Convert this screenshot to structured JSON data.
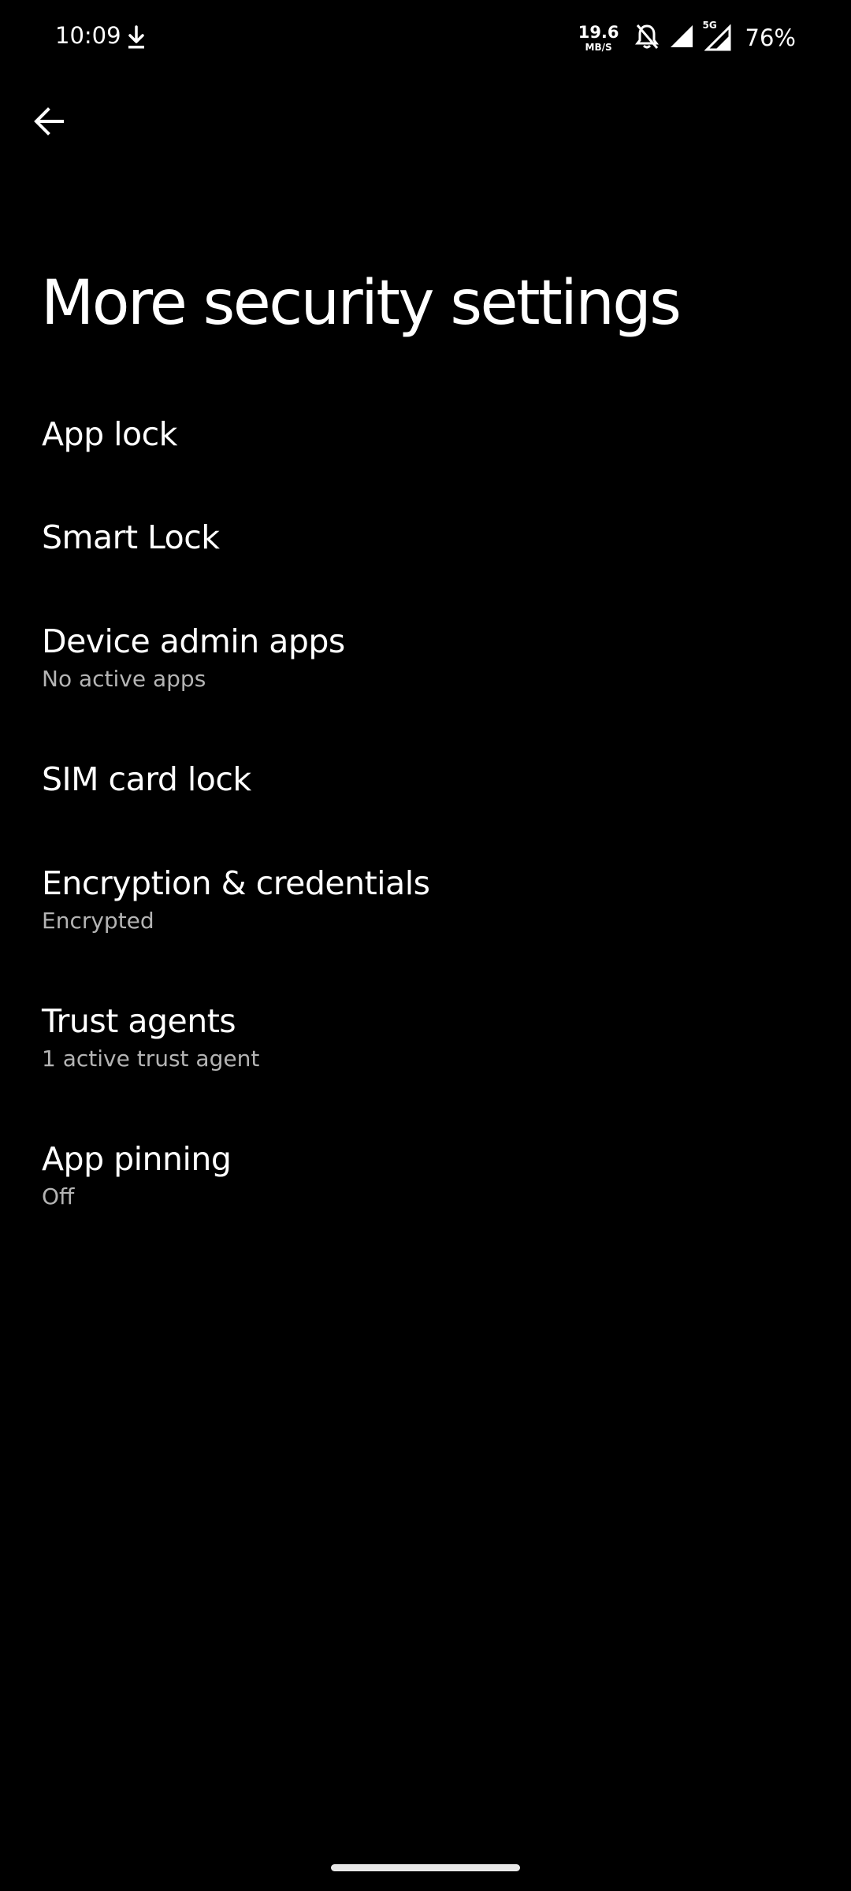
{
  "status_bar": {
    "time": "10:09",
    "net_speed_value": "19.6",
    "net_speed_unit": "MB/S",
    "network_tag": "5G",
    "battery": "76%",
    "icons": [
      "download-icon",
      "notifications-off-icon",
      "signal-icon",
      "signal-5g-icon"
    ]
  },
  "header": {
    "back_icon": "arrow-back-icon",
    "title": "More security settings"
  },
  "items": [
    {
      "title": "App lock",
      "summary": ""
    },
    {
      "title": "Smart Lock",
      "summary": ""
    },
    {
      "title": "Device admin apps",
      "summary": "No active apps"
    },
    {
      "title": "SIM card lock",
      "summary": ""
    },
    {
      "title": "Encryption & credentials",
      "summary": "Encrypted"
    },
    {
      "title": "Trust agents",
      "summary": "1 active trust agent"
    },
    {
      "title": "App pinning",
      "summary": "Off"
    }
  ],
  "colors": {
    "background": "#000000",
    "primary_text": "#ffffff",
    "secondary_text": "#b4b4b4"
  }
}
